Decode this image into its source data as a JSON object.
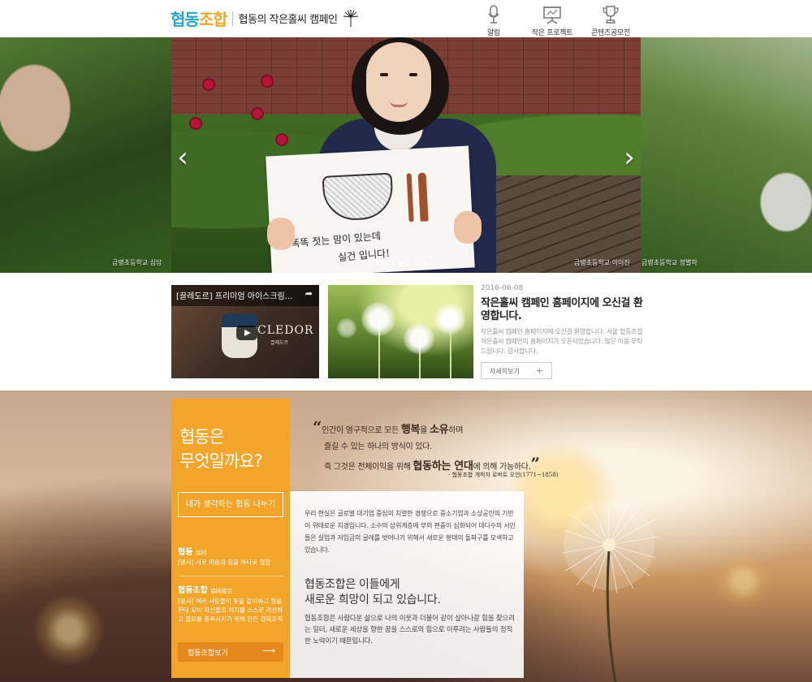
{
  "header": {
    "logo_part1": "협동",
    "logo_part2": "조합",
    "title": "협동의 작은홀씨 캠페인",
    "nav": [
      {
        "label": "알림",
        "icon": "microphone-icon"
      },
      {
        "label": "작은 프로젝트",
        "icon": "presentation-board-icon"
      },
      {
        "label": "콘텐츠공모전",
        "icon": "trophy-icon"
      }
    ]
  },
  "hero": {
    "captions": {
      "left": "금병초등학교 심담",
      "main": "금병초등학교 이이진",
      "right": "금병초등학교 정별하"
    },
    "sign_lines": [
      "똑똑 젓는 맘이 있는데",
      "실건 입니다!"
    ],
    "prev_icon": "chevron-left-icon",
    "next_icon": "chevron-right-icon",
    "dots": 4
  },
  "video": {
    "title": "[끌레도르] 프리미엄 아이스크림...",
    "brand": "CLEDOR",
    "brand_sub": "끌레도르"
  },
  "news": {
    "date": "2016-06-08",
    "title": "작은홀씨 캠페인 홈페이지에 오신걸 환영합니다.",
    "body": "작은홀씨 캠페인 홈페이지에 오신걸 환영합니다. 서울 협동조합 작은홀씨 캠페인의 홈페이지가 오픈되었습니다. 많은 이용 부탁드립니다. 감사합니다.",
    "more_label": "자세히보기",
    "more_icon": "+"
  },
  "coop": {
    "question_line1": "협동은",
    "question_line2": "무엇일까요?",
    "share_button": "내가 생각하는 협동 나누기",
    "def1_word": "협동",
    "def1_hanja": "協同",
    "def1_text": "[명사] 서로 마음과 힘을 하나로 합함",
    "def2_word": "협동조합",
    "def2_hanja": "協同組合",
    "def2_text": "[명사] 여러 사람들이 뜻을 같이하고 힘을 한데 모아 자신들의 처지를 스스로 개선하고 필요를 충족시키기 위해 만든 경제조직",
    "coop_button": "협동조합보기",
    "coop_arrow": "⟶"
  },
  "quote": {
    "open_mark": "“",
    "close_mark": "”",
    "line1_a": "인간이 영구적으로 모든 ",
    "line1_b": "행복",
    "line1_c": "을 ",
    "line1_d": "소유",
    "line1_e": "하며",
    "line2": "즐길 수 있는 하나의 방식이 있다.",
    "line3_a": "즉 그것은 전체이익을 위해 ",
    "line3_b": "협동하는 연대",
    "line3_c": "에 의해 가능하다.",
    "source": "- 협동조합 개척자 로버트 오언(1771~1858)"
  },
  "story": {
    "paragraph": "우리 현실은 글로벌 대기업 중심의 치열한 경쟁으로 중소기업과 소상공인의 기반이 위태로운 지경입니다. 소수의 상위계층에 부의 편중이 심화되어 대다수의 서민들은 실업과 저임금의 굴레를 벗어나기 위해서 새로운 형태의 돌파구를 모색하고 있습니다.",
    "headline_line1": "협동조합은 이들에게",
    "headline_line2": "새로운 희망이 되고 있습니다.",
    "closing": "협동조합은 사람다운 삶으로 나의 이웃과 더불어 같이 살아나갈 힘을 찾으려는 일터, 새로운 세상을 향한 꿈을 스스로의 힘으로 이루려는 사람들의 정직한 노력이기 때문입니다."
  }
}
